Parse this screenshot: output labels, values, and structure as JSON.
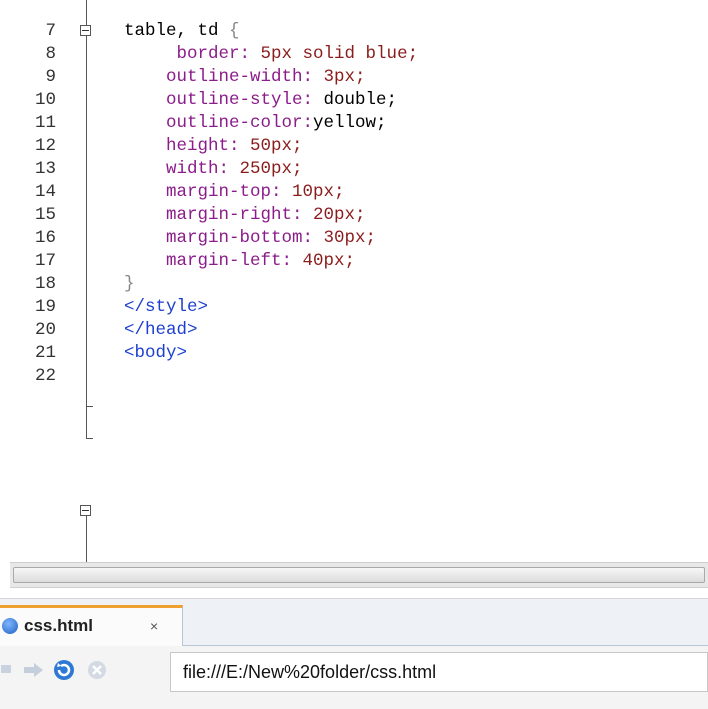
{
  "editor": {
    "lines": [
      {
        "num": "7",
        "tokens": [
          {
            "t": "table, td ",
            "c": "t-sel"
          },
          {
            "t": "{",
            "c": "t-brace"
          }
        ]
      },
      {
        "num": "8",
        "tokens": [
          {
            "t": "     border: ",
            "c": "t-prop"
          },
          {
            "t": "5px",
            "c": "t-num"
          },
          {
            "t": " solid blue;",
            "c": "t-val"
          }
        ]
      },
      {
        "num": "9",
        "tokens": [
          {
            "t": "    outline-width: ",
            "c": "t-prop"
          },
          {
            "t": "3px;",
            "c": "t-num"
          }
        ]
      },
      {
        "num": "10",
        "tokens": [
          {
            "t": "    outline-style: ",
            "c": "t-prop"
          },
          {
            "t": "double;",
            "c": "t-key"
          }
        ]
      },
      {
        "num": "11",
        "tokens": [
          {
            "t": "    outline-color:",
            "c": "t-prop"
          },
          {
            "t": "yellow;",
            "c": "t-key"
          }
        ]
      },
      {
        "num": "12",
        "tokens": [
          {
            "t": "    height: ",
            "c": "t-prop"
          },
          {
            "t": "50px;",
            "c": "t-num"
          }
        ]
      },
      {
        "num": "13",
        "tokens": [
          {
            "t": "    width: ",
            "c": "t-prop"
          },
          {
            "t": "250px;",
            "c": "t-num"
          }
        ]
      },
      {
        "num": "14",
        "tokens": [
          {
            "t": "    margin-top: ",
            "c": "t-prop"
          },
          {
            "t": "10px;",
            "c": "t-num"
          }
        ]
      },
      {
        "num": "15",
        "tokens": [
          {
            "t": "    margin-right: ",
            "c": "t-prop"
          },
          {
            "t": "20px;",
            "c": "t-num"
          }
        ]
      },
      {
        "num": "16",
        "tokens": [
          {
            "t": "    margin-bottom: ",
            "c": "t-prop"
          },
          {
            "t": "30px;",
            "c": "t-num"
          }
        ]
      },
      {
        "num": "17",
        "tokens": [
          {
            "t": "    margin-left: ",
            "c": "t-prop"
          },
          {
            "t": "40px;",
            "c": "t-num"
          }
        ]
      },
      {
        "num": "18",
        "tokens": [
          {
            "t": "}",
            "c": "t-brace"
          }
        ]
      },
      {
        "num": "19",
        "tokens": [
          {
            "t": "</style>",
            "c": "t-tag"
          }
        ]
      },
      {
        "num": "20",
        "tokens": [
          {
            "t": "</head>",
            "c": "t-tag"
          }
        ]
      },
      {
        "num": "21",
        "tokens": [
          {
            "t": "<body>",
            "c": "t-tag"
          }
        ]
      },
      {
        "num": "22",
        "tokens": []
      }
    ]
  },
  "browser": {
    "tab_label": "css.html",
    "tab_close": "×",
    "url": "file:///E:/New%20folder/css.html",
    "icons": [
      "back-arrow-icon",
      "forward-arrow-icon",
      "refresh-icon",
      "stop-icon"
    ]
  },
  "colors": {
    "property": "#8b1c8b",
    "value": "#8b1c1c",
    "tag": "#1d3fd0",
    "tab_accent": "#f0a030"
  }
}
